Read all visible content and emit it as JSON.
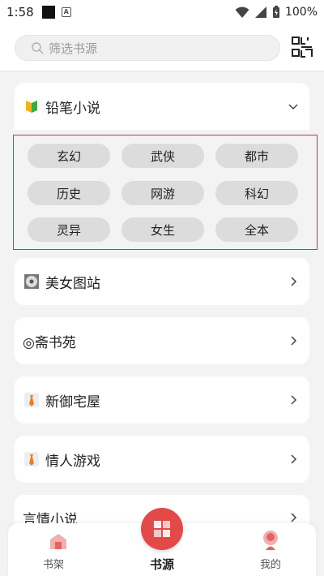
{
  "status_bar": {
    "time": "1:58",
    "battery": "100%"
  },
  "search": {
    "placeholder": "筛选书源"
  },
  "sources": [
    {
      "name": "铅笔小说",
      "icon": "pencil-novel-icon",
      "expanded": true
    },
    {
      "name": "美女图站",
      "icon": "disc-icon"
    },
    {
      "name": "◎斋书苑",
      "icon": ""
    },
    {
      "name": "新御宅屋",
      "icon": "tie-icon"
    },
    {
      "name": "情人游戏",
      "icon": "tie-icon"
    },
    {
      "name": "言情小说",
      "icon": ""
    }
  ],
  "genres": [
    "玄幻",
    "武侠",
    "都市",
    "历史",
    "网游",
    "科幻",
    "灵异",
    "女生",
    "全本"
  ],
  "bottom_nav": {
    "bookshelf": "书架",
    "sources": "书源",
    "mine": "我的"
  },
  "colors": {
    "accent": "#e24a4a",
    "highlight_border": "#c23b3b"
  }
}
